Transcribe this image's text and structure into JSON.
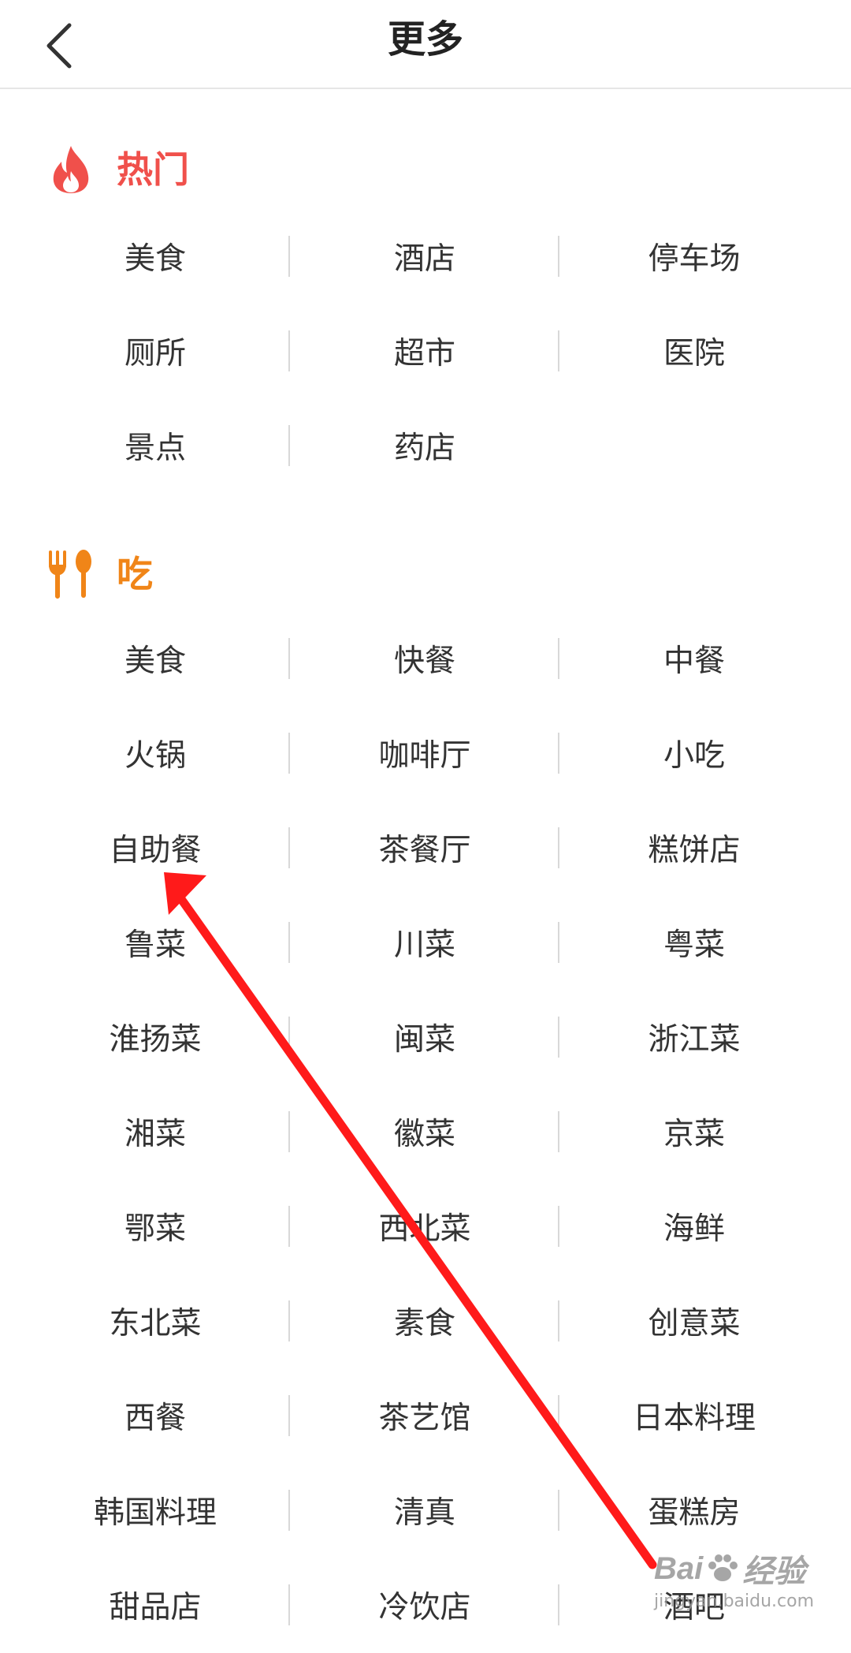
{
  "header": {
    "title": "更多",
    "back_icon": "chevron-left-icon"
  },
  "sections": [
    {
      "id": "hot",
      "title": "热门",
      "icon": "flame-icon",
      "color": "#f0504b",
      "items": [
        "美食",
        "酒店",
        "停车场",
        "厕所",
        "超市",
        "医院",
        "景点",
        "药店"
      ]
    },
    {
      "id": "eat",
      "title": "吃",
      "icon": "fork-spoon-icon",
      "color": "#f08518",
      "items": [
        "美食",
        "快餐",
        "中餐",
        "火锅",
        "咖啡厅",
        "小吃",
        "自助餐",
        "茶餐厅",
        "糕饼店",
        "鲁菜",
        "川菜",
        "粤菜",
        "淮扬菜",
        "闽菜",
        "浙江菜",
        "湘菜",
        "徽菜",
        "京菜",
        "鄂菜",
        "西北菜",
        "海鲜",
        "东北菜",
        "素食",
        "创意菜",
        "西餐",
        "茶艺馆",
        "日本料理",
        "韩国料理",
        "清真",
        "蛋糕房",
        "甜品店",
        "冷饮店",
        "酒吧"
      ]
    }
  ],
  "annotation": {
    "arrow_color": "#ff1a1a",
    "points_to": "自助餐"
  },
  "watermark": {
    "brand_left": "Bai",
    "brand_right": "经验",
    "sub": "jingyan.baidu.com"
  }
}
